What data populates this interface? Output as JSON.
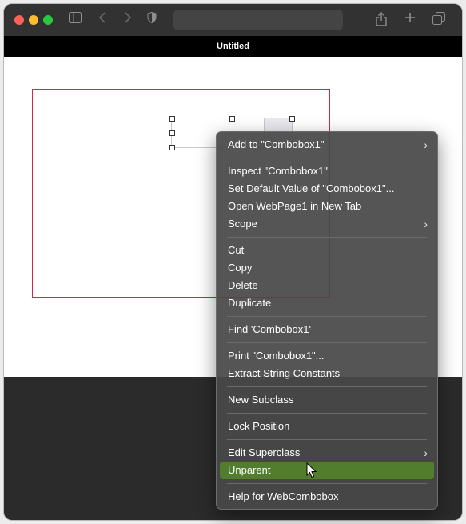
{
  "window": {
    "title": "Untitled"
  },
  "menu": {
    "items": [
      {
        "label": "Add to \"Combobox1\"",
        "submenu": true
      },
      {
        "label": "Inspect \"Combobox1\""
      },
      {
        "label": "Set Default Value of \"Combobox1\"..."
      },
      {
        "label": "Open WebPage1 in New Tab"
      },
      {
        "label": "Scope",
        "submenu": true
      },
      {
        "label": "Cut"
      },
      {
        "label": "Copy"
      },
      {
        "label": "Delete"
      },
      {
        "label": "Duplicate"
      },
      {
        "label": "Find 'Combobox1'"
      },
      {
        "label": "Print \"Combobox1\"..."
      },
      {
        "label": "Extract String Constants"
      },
      {
        "label": "New Subclass"
      },
      {
        "label": "Lock Position"
      },
      {
        "label": "Edit Superclass",
        "submenu": true
      },
      {
        "label": "Unparent",
        "highlighted": true
      },
      {
        "label": "Help for WebCombobox"
      }
    ],
    "highlight_color": "#537d2e"
  },
  "icons": {
    "chevron": "›",
    "sidebar": "sidebar-icon",
    "back": "chevron-left-icon",
    "forward": "chevron-right-icon",
    "share": "share-icon",
    "new_tab": "plus-icon",
    "tabs": "tabs-overview-icon"
  }
}
